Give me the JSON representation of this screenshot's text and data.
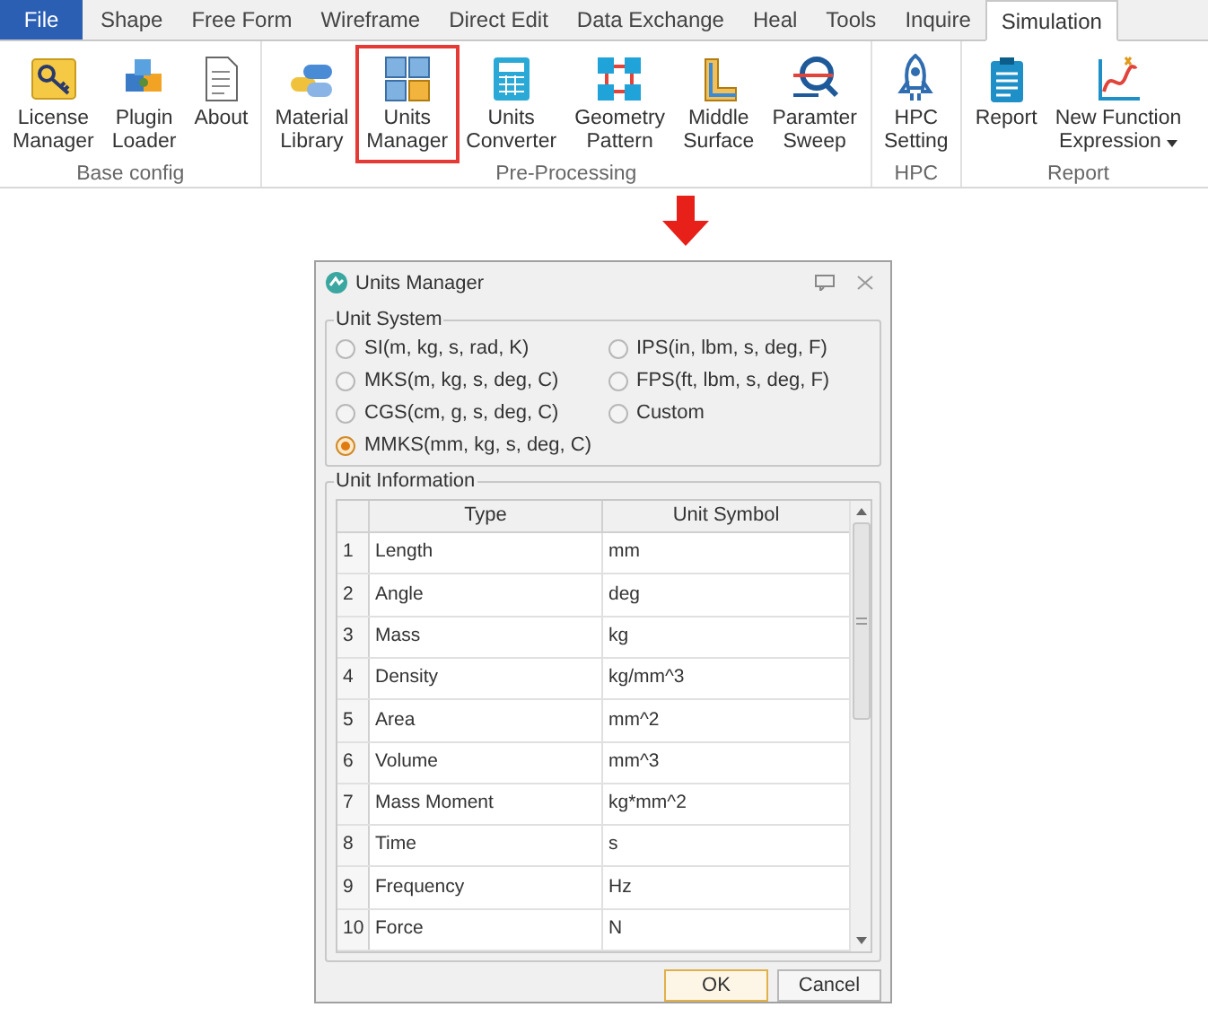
{
  "menu_tabs": [
    {
      "label": "File",
      "kind": "file",
      "selected": false
    },
    {
      "label": "Shape",
      "kind": "tab",
      "selected": false
    },
    {
      "label": "Free Form",
      "kind": "tab",
      "selected": false
    },
    {
      "label": "Wireframe",
      "kind": "tab",
      "selected": false
    },
    {
      "label": "Direct Edit",
      "kind": "tab",
      "selected": false
    },
    {
      "label": "Data Exchange",
      "kind": "tab",
      "selected": false
    },
    {
      "label": "Heal",
      "kind": "tab",
      "selected": false
    },
    {
      "label": "Tools",
      "kind": "tab",
      "selected": false
    },
    {
      "label": "Inquire",
      "kind": "tab",
      "selected": false
    },
    {
      "label": "Simulation",
      "kind": "tab",
      "selected": true
    }
  ],
  "ribbon_groups": [
    {
      "label": "Base config",
      "buttons": [
        {
          "lines": [
            "License",
            "Manager"
          ],
          "highlighted": false
        },
        {
          "lines": [
            "Plugin",
            "Loader"
          ],
          "highlighted": false
        },
        {
          "lines": [
            "About"
          ],
          "highlighted": false
        }
      ]
    },
    {
      "label": "Pre-Processing",
      "buttons": [
        {
          "lines": [
            "Material",
            "Library"
          ],
          "highlighted": false
        },
        {
          "lines": [
            "Units",
            "Manager"
          ],
          "highlighted": true
        },
        {
          "lines": [
            "Units",
            "Converter"
          ],
          "highlighted": false
        },
        {
          "lines": [
            "Geometry",
            "Pattern"
          ],
          "highlighted": false
        },
        {
          "lines": [
            "Middle",
            "Surface"
          ],
          "highlighted": false
        },
        {
          "lines": [
            "Paramter",
            "Sweep"
          ],
          "highlighted": false
        }
      ]
    },
    {
      "label": "HPC",
      "buttons": [
        {
          "lines": [
            "HPC",
            "Setting"
          ],
          "highlighted": false
        }
      ]
    },
    {
      "label": "Report",
      "buttons": [
        {
          "lines": [
            "Report"
          ],
          "highlighted": false
        },
        {
          "lines": [
            "New Function",
            "Expression"
          ],
          "highlighted": false,
          "dropdown": true
        }
      ]
    }
  ],
  "dialog": {
    "title": "Units Manager",
    "unit_system": {
      "label": "Unit System",
      "options": [
        {
          "label": "SI(m, kg, s, rad, K)",
          "selected": false
        },
        {
          "label": "IPS(in, lbm, s, deg, F)",
          "selected": false
        },
        {
          "label": "MKS(m, kg, s, deg, C)",
          "selected": false
        },
        {
          "label": "FPS(ft, lbm, s, deg, F)",
          "selected": false
        },
        {
          "label": "CGS(cm, g, s, deg, C)",
          "selected": false
        },
        {
          "label": "Custom",
          "selected": false
        },
        {
          "label": "MMKS(mm, kg, s, deg, C)",
          "selected": true
        }
      ]
    },
    "unit_information": {
      "label": "Unit Information",
      "columns": [
        "Type",
        "Unit Symbol"
      ],
      "rows": [
        [
          "1",
          "Length",
          "mm"
        ],
        [
          "2",
          "Angle",
          "deg"
        ],
        [
          "3",
          "Mass",
          "kg"
        ],
        [
          "4",
          "Density",
          "kg/mm^3"
        ],
        [
          "5",
          "Area",
          "mm^2"
        ],
        [
          "6",
          "Volume",
          "mm^3"
        ],
        [
          "7",
          "Mass Moment",
          "kg*mm^2"
        ],
        [
          "8",
          "Time",
          "s"
        ],
        [
          "9",
          "Frequency",
          "Hz"
        ],
        [
          "10",
          "Force",
          "N"
        ]
      ]
    },
    "buttons": [
      {
        "label": "OK",
        "default": true
      },
      {
        "label": "Cancel",
        "default": false
      }
    ]
  }
}
